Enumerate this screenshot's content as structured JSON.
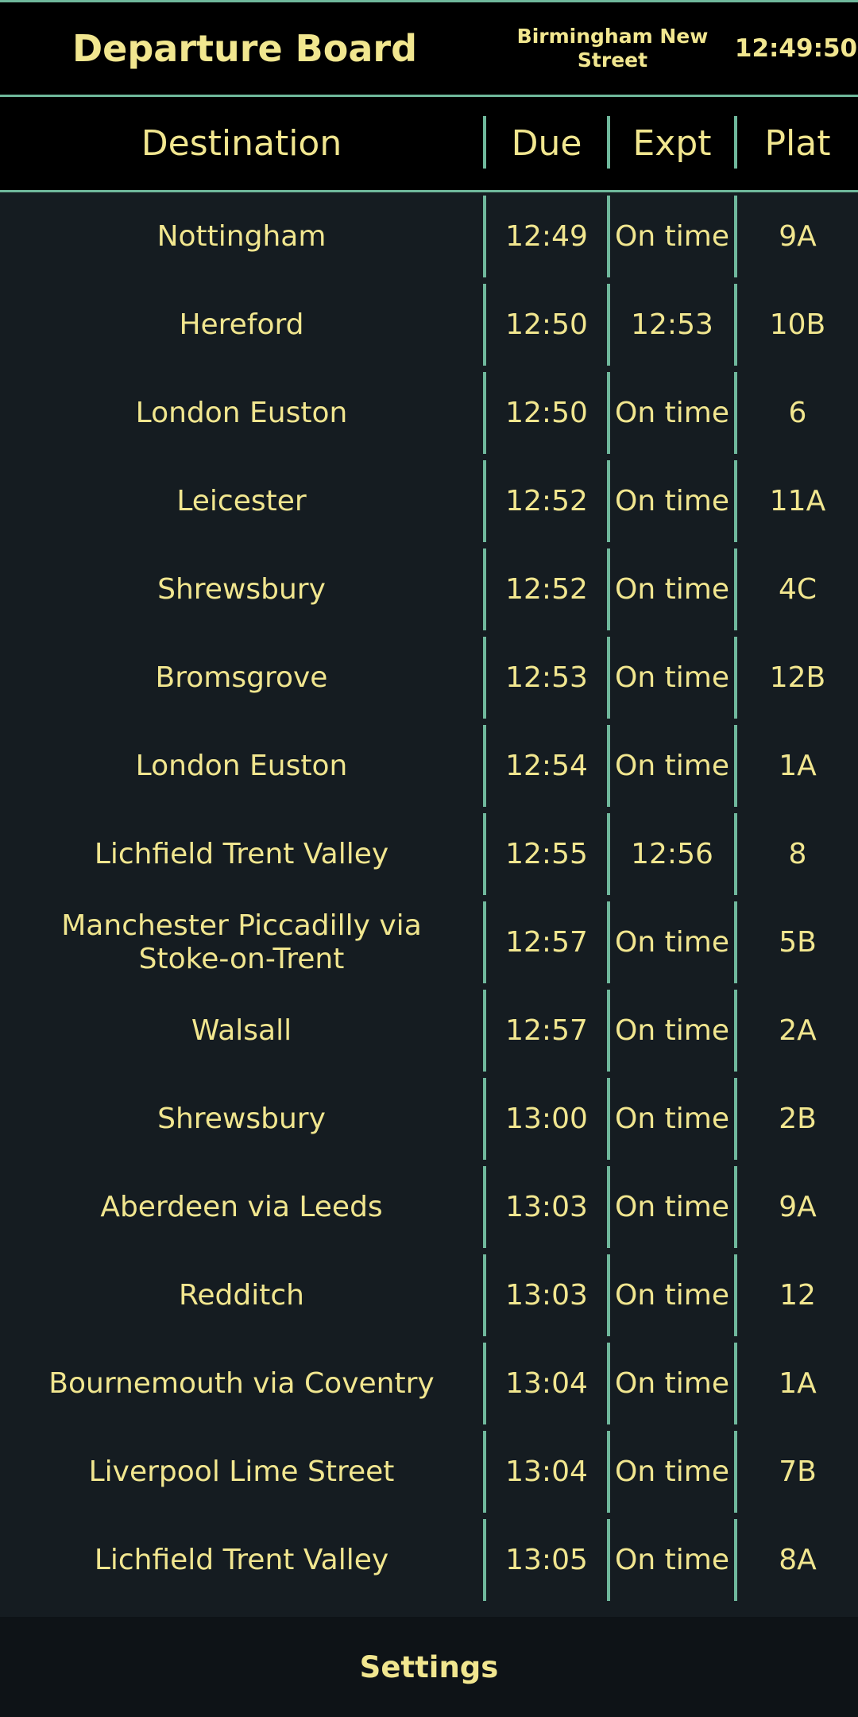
{
  "header": {
    "title": "Departure Board",
    "station": "Birmingham New Street",
    "clock": "12:49:50"
  },
  "columns": {
    "destination": "Destination",
    "due": "Due",
    "expected": "Expt",
    "platform": "Plat"
  },
  "departures": [
    {
      "destination": "Nottingham",
      "due": "12:49",
      "expected": "On time",
      "platform": "9A"
    },
    {
      "destination": "Hereford",
      "due": "12:50",
      "expected": "12:53",
      "platform": "10B"
    },
    {
      "destination": "London Euston",
      "due": "12:50",
      "expected": "On time",
      "platform": "6"
    },
    {
      "destination": "Leicester",
      "due": "12:52",
      "expected": "On time",
      "platform": "11A"
    },
    {
      "destination": "Shrewsbury",
      "due": "12:52",
      "expected": "On time",
      "platform": "4C"
    },
    {
      "destination": "Bromsgrove",
      "due": "12:53",
      "expected": "On time",
      "platform": "12B"
    },
    {
      "destination": "London Euston",
      "due": "12:54",
      "expected": "On time",
      "platform": "1A"
    },
    {
      "destination": "Lichfield Trent Valley",
      "due": "12:55",
      "expected": "12:56",
      "platform": "8"
    },
    {
      "destination": "Manchester Piccadilly via Stoke-on-Trent",
      "due": "12:57",
      "expected": "On time",
      "platform": "5B"
    },
    {
      "destination": "Walsall",
      "due": "12:57",
      "expected": "On time",
      "platform": "2A"
    },
    {
      "destination": "Shrewsbury",
      "due": "13:00",
      "expected": "On time",
      "platform": "2B"
    },
    {
      "destination": "Aberdeen via Leeds",
      "due": "13:03",
      "expected": "On time",
      "platform": "9A"
    },
    {
      "destination": "Redditch",
      "due": "13:03",
      "expected": "On time",
      "platform": "12"
    },
    {
      "destination": "Bournemouth via Coventry",
      "due": "13:04",
      "expected": "On time",
      "platform": "1A"
    },
    {
      "destination": "Liverpool Lime Street",
      "due": "13:04",
      "expected": "On time",
      "platform": "7B"
    },
    {
      "destination": "Lichfield Trent Valley",
      "due": "13:05",
      "expected": "On time",
      "platform": "8A"
    }
  ],
  "footer": {
    "settings_label": "Settings"
  },
  "colors": {
    "background": "#151c21",
    "text": "#f1e68f",
    "accent": "#6fb89c",
    "bar": "#000000"
  }
}
